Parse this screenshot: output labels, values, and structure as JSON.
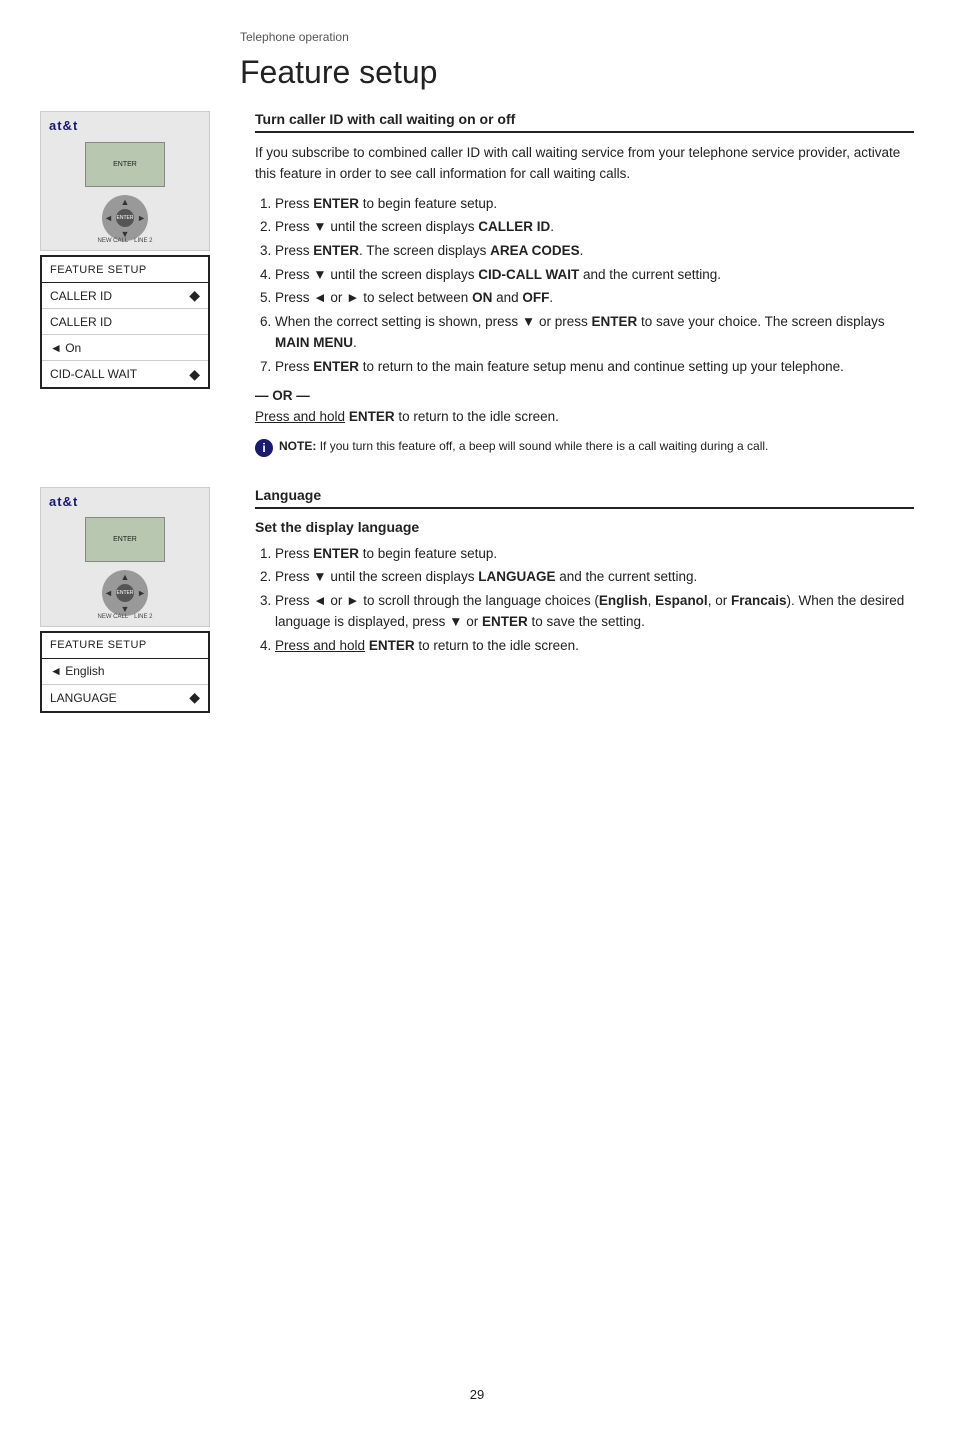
{
  "breadcrumb": "Telephone operation",
  "page_title": "Feature setup",
  "caller_id_section": {
    "heading": "Turn caller ID with call waiting on or off",
    "intro": "If you subscribe to combined caller ID with call waiting service from your telephone service provider, activate this feature in order to see call information for call waiting calls.",
    "steps": [
      "Press <b>ENTER</b> to begin feature setup.",
      "Press ▼ until the screen displays <b>CALLER ID</b>.",
      "Press <b>ENTER</b>. The screen displays <b>AREA CODES</b>.",
      "Press ▼ until the screen displays <b>CID-CALL WAIT</b> and the current setting.",
      "Press ◄ or ► to select between <b>ON</b> and <b>OFF</b>.",
      "When the correct setting is shown, press ▼ or press <b>ENTER</b> to save your choice. The screen displays <b>MAIN MENU</b>.",
      "Press <b>ENTER</b> to return to the main feature setup menu and continue setting up your telephone."
    ],
    "or_text": "— OR —",
    "or_action": "Press and hold <b>ENTER</b> to return to the idle screen.",
    "note_label": "NOTE:",
    "note_text": "If you turn this feature off, a beep will sound while there is a call waiting during a call.",
    "device": {
      "brand": "at&t",
      "screen_text": "ENTER"
    },
    "lcd": {
      "row1": "FEATURE SETUP",
      "row2_left": "CALLER ID",
      "row2_right": "◆",
      "row3": "CALLER ID",
      "row4_left": "◄ On",
      "row4_right": "",
      "row5_left": "CID-CALL WAIT",
      "row5_right": "◆"
    }
  },
  "language_section": {
    "heading": "Language",
    "subheading": "Set the display language",
    "steps": [
      "Press <b>ENTER</b> to begin feature setup.",
      "Press ▼ until the screen displays <b>LANGUAGE</b> and the current setting.",
      "Press ◄ or ► to scroll through the language choices (<b>English</b>, <b>Espanol</b>, or <b>Francais</b>). When the desired language is displayed, press ▼ or <b>ENTER</b> to save the setting.",
      "Press and hold <b>ENTER</b> to return to the idle screen."
    ],
    "device": {
      "brand": "at&t",
      "screen_text": "ENTER"
    },
    "lcd": {
      "row1": "FEATURE SETUP",
      "row2_left": "◄ English",
      "row3_left": "LANGUAGE",
      "row3_right": "◆"
    }
  },
  "page_number": "29"
}
